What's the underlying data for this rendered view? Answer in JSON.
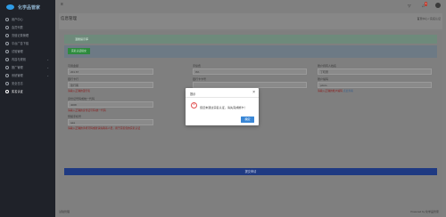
{
  "app": {
    "brand": "化学品管家"
  },
  "sidebar": {
    "items": [
      {
        "label": "用户中心",
        "icon": "dashboard-icon"
      },
      {
        "label": "会员列表",
        "icon": "users-icon"
      },
      {
        "label": "充值记录管理",
        "icon": "wallet-icon"
      },
      {
        "label": "平台广告下载",
        "icon": "download-icon"
      },
      {
        "label": "试验管理",
        "icon": "flask-icon"
      },
      {
        "label": "内容与规则",
        "icon": "file-icon"
      },
      {
        "label": "推广管理",
        "icon": "share-icon"
      },
      {
        "label": "系统管理",
        "icon": "gear-icon"
      },
      {
        "label": "安全日志",
        "icon": "shield-icon"
      },
      {
        "label": "实名认证",
        "icon": "id-card-icon"
      }
    ]
  },
  "topbar": {
    "badge": "1"
  },
  "header": {
    "title": "信息管理",
    "breadcrumb": "首页中心 / 实名认证"
  },
  "form": {
    "alert": "温馨提示库",
    "verify_button": "实名认证提交",
    "labels": {
      "balance": "可用金额",
      "rate": "手续费",
      "account_name": "账户持有人姓名",
      "bank": "银行卡行",
      "card_no": "银行卡卡号",
      "bank_code": "账户编码",
      "id_no": "身份证号码或统一代码",
      "phone": "预留手机号"
    },
    "values": {
      "balance": "201.67",
      "rate": "0%",
      "account_name": "丁晓蕾",
      "bank": "建行客",
      "card_no": "",
      "bank_code": "pdoto",
      "id_no": "4008",
      "phone": "aaa"
    },
    "hints": {
      "bank": "请输入正确的银行名",
      "bank_code": "请输入正确的账户编码",
      "bank_code_link": "点此查看",
      "id_no": "请输入正确的身份证号码/统一代码",
      "phone": "请输入正确的手机号码或者请先联系人员，用于完善您的实名认证"
    },
    "submit": "提交申请"
  },
  "footer": {
    "left": "试验管理",
    "right": "Powered by 化学品管家"
  },
  "modal": {
    "title": "提示",
    "message": "您还未通过实名认证，请先完成绑卡！",
    "ok": "确定"
  }
}
